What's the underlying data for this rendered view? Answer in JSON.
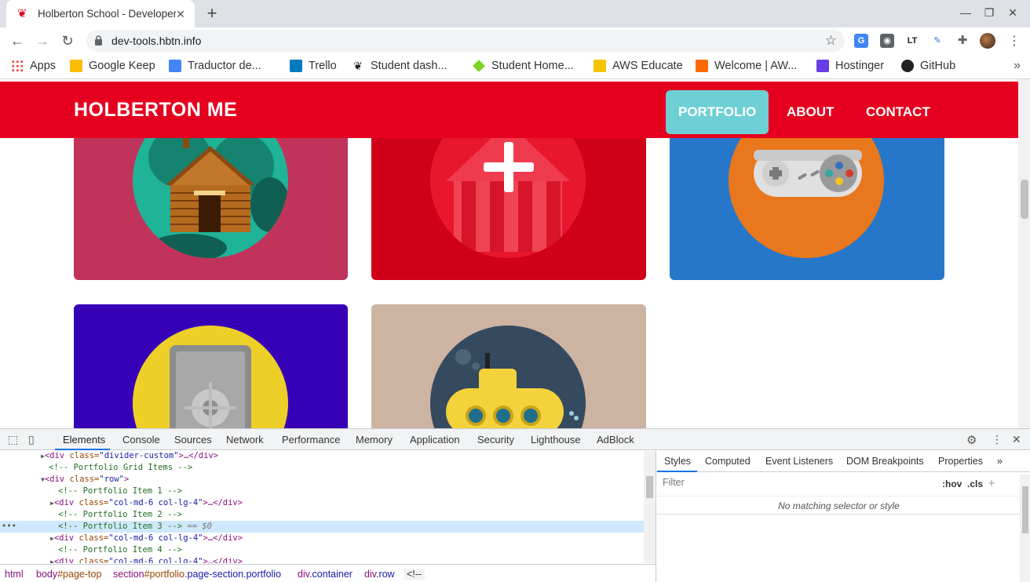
{
  "browser": {
    "tab_title": "Holberton School - Developer",
    "tab_close": "✕",
    "new_tab": "+",
    "url": "dev-tools.hbtn.info"
  },
  "bookmarks": [
    {
      "label": "Apps",
      "color": "#ea4335"
    },
    {
      "label": "Google Keep",
      "color": "#fbbc04"
    },
    {
      "label": "Traductor de...",
      "color": "#4285f4"
    },
    {
      "label": "Trello",
      "color": "#0079bf"
    },
    {
      "label": "Student dash...",
      "color": "#222222"
    },
    {
      "label": "Student Home...",
      "color": "#7ed321"
    },
    {
      "label": "AWS Educate",
      "color": "#f5c400"
    },
    {
      "label": "Welcome | AW...",
      "color": "#ff6a00"
    },
    {
      "label": "Hostinger",
      "color": "#673de6"
    },
    {
      "label": "GitHub",
      "color": "#222222"
    }
  ],
  "site": {
    "brand": "HOLBERTON ME",
    "nav": [
      "PORTFOLIO",
      "ABOUT",
      "CONTACT"
    ],
    "accent": "#e5001f",
    "active_nav_color": "#6ecfd4",
    "cards": [
      {
        "name": "cabin",
        "bg": "#c0335b",
        "circle": "#1fb398"
      },
      {
        "name": "circus-tent",
        "bg": "#e5001f",
        "circle": "#e8172d"
      },
      {
        "name": "game-controller",
        "bg": "#2677c9",
        "circle": "#e9771d"
      },
      {
        "name": "safe",
        "bg": "#3601b6",
        "circle": "#eecf28"
      },
      {
        "name": "submarine",
        "bg": "#cdb3a2",
        "circle": "#354a5f"
      }
    ]
  },
  "devtools": {
    "tabs": [
      "Elements",
      "Console",
      "Sources",
      "Network",
      "Performance",
      "Memory",
      "Application",
      "Security",
      "Lighthouse",
      "AdBlock"
    ],
    "dom": {
      "l1_tag": "<div",
      "l1_attr": "class=",
      "l1_val": "\"divider-custom\"",
      "l1_rest": ">…</div>",
      "l2": "<!-- Portfolio Grid Items -->",
      "l3_tag": "<div",
      "l3_attr": "class=",
      "l3_val": "\"row\"",
      "l3_rest": ">",
      "l4": "<!-- Portfolio Item 1 -->",
      "l5_tag": "<div",
      "l5_attr": "class=",
      "l5_val": "\"col-md-6 col-lg-4\"",
      "l5_rest": ">…</div>",
      "l6": "<!-- Portfolio Item 2 -->",
      "l7": "<!-- Portfolio Item 3 -->",
      "l7_suffix": "== $0",
      "l8_tag": "<div",
      "l8_attr": "class=",
      "l8_val": "\"col-md-6 col-lg-4\"",
      "l8_rest": ">…</div>",
      "l9": "<!-- Portfolio Item 4 -->",
      "l10_tag": "<div",
      "l10_attr": "class=",
      "l10_val": "\"col-md-6 col-lg-4\"",
      "l10_rest": ">…</div>"
    },
    "breadcrumb": {
      "c1": "html",
      "c2_tag": "body",
      "c2_id": "#page-top",
      "c3_tag": "section",
      "c3_id": "#portfolio",
      "c3_cls": ".page-section.portfolio",
      "c4_tag": "div",
      "c4_cls": ".container",
      "c5_tag": "div",
      "c5_cls": ".row",
      "c6": "<!--"
    },
    "styles_tabs": [
      "Styles",
      "Computed",
      "Event Listeners",
      "DOM Breakpoints",
      "Properties"
    ],
    "filter_placeholder": "Filter",
    "filter_hov": ":hov",
    "filter_cls": ".cls",
    "no_match": "No matching selector or style"
  }
}
